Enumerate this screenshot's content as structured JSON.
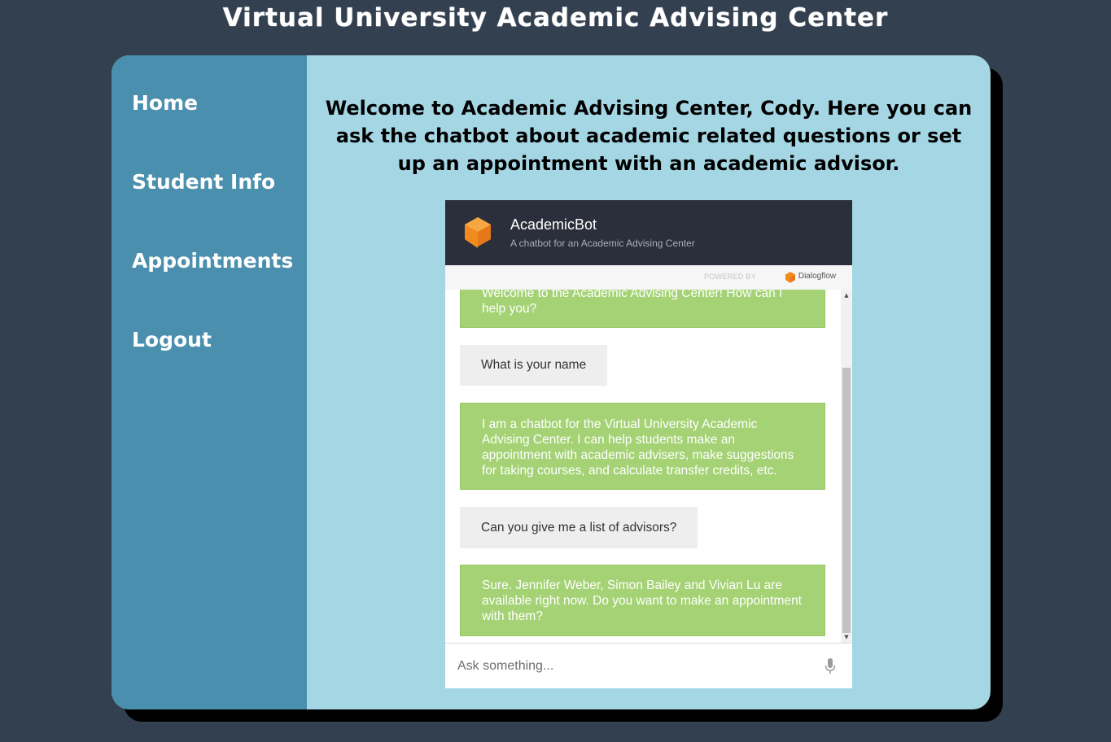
{
  "page": {
    "title": "Virtual University Academic Advising Center"
  },
  "sidebar": {
    "items": [
      {
        "label": "Home"
      },
      {
        "label": "Student Info"
      },
      {
        "label": "Appointments"
      },
      {
        "label": "Logout"
      }
    ]
  },
  "main": {
    "welcome": "Welcome to Academic Advising Center, Cody. Here you can ask the chatbot about academic related questions or set up an appointment with an academic advisor."
  },
  "chat": {
    "bot_name": "AcademicBot",
    "bot_description": "A chatbot for an Academic Advising Center",
    "powered_by": "POWERED BY",
    "provider": "Dialogflow",
    "messages": [
      {
        "from": "bot",
        "text": "Welcome to the Academic Advising Center! How can I help you?"
      },
      {
        "from": "user",
        "text": "What is your name"
      },
      {
        "from": "bot",
        "text": "I am a chatbot for the Virtual University Academic Advising Center. I can help students make an appointment with academic advisers, make suggestions for taking courses, and calculate transfer credits, etc."
      },
      {
        "from": "user",
        "text": "Can you give me a list of advisors?"
      },
      {
        "from": "bot",
        "text": "Sure. Jennifer Weber, Simon Bailey and Vivian Lu are available right now. Do you want to make an appointment with them?"
      }
    ],
    "input_placeholder": "Ask something..."
  },
  "colors": {
    "background": "#33404f",
    "sidebar": "#4a8fad",
    "content": "#a4d6e3",
    "chat_header": "#2b2f3b",
    "bot_bubble": "#a4d274",
    "user_bubble": "#eeeeee",
    "accent": "#f08c1e"
  },
  "icons": {
    "bot_logo": "dialogflow-cube-icon",
    "microphone": "mic-icon",
    "scroll_up": "arrow-up-icon",
    "scroll_down": "arrow-down-icon"
  }
}
